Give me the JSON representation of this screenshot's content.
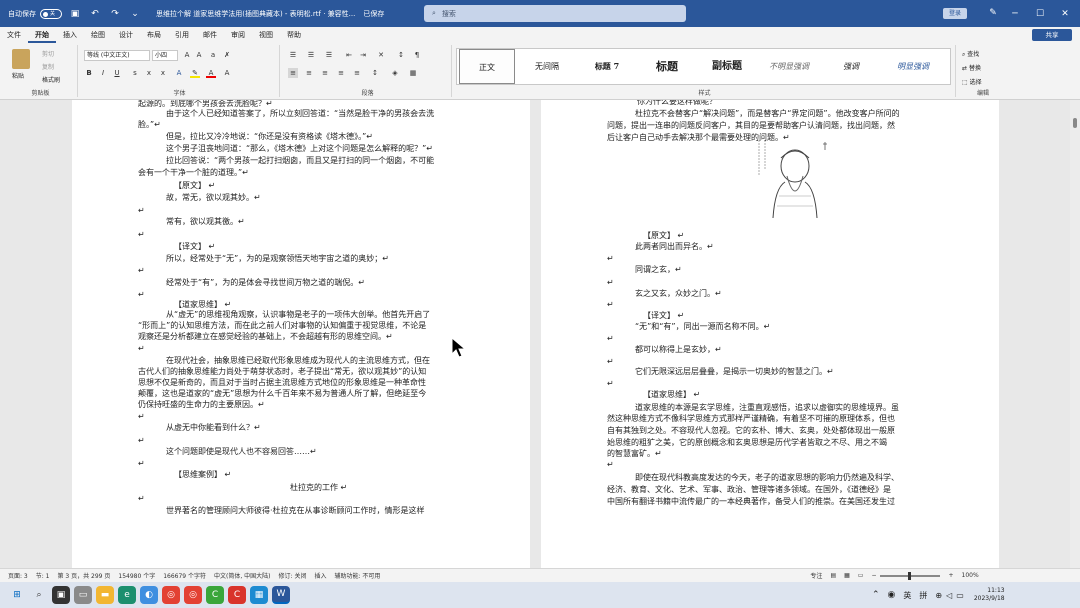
{
  "titlebar": {
    "autosave": "自动保存",
    "toggle": "关",
    "filename": "思维拉个解 道家思维学法用(插图典藏本) - 表明松.rtf · 兼容性...",
    "saved": "已保存",
    "search_placeholder": "搜索",
    "signin": "登录"
  },
  "menu": [
    "文件",
    "开始",
    "插入",
    "绘图",
    "设计",
    "布局",
    "引用",
    "邮件",
    "审阅",
    "视图",
    "帮助"
  ],
  "share": "共享",
  "ribbon": {
    "clipboard": {
      "paste": "粘贴",
      "cut": "剪切",
      "copy": "复制",
      "format_painter": "格式刷",
      "label": "剪贴板"
    },
    "font": {
      "name": "等线 (中文正文)",
      "size": "小四",
      "label": "字体"
    },
    "paragraph": {
      "label": "段落"
    },
    "styles": {
      "items": [
        "正文",
        "无间隔",
        "标题 7",
        "标题",
        "副标题",
        "不明显强调",
        "强调",
        "明显强调"
      ],
      "label": "样式"
    },
    "editing": {
      "find": "查找",
      "replace": "替换",
      "select": "选择",
      "label": "编辑"
    }
  },
  "page_left": [
    "起源的。到底哪个男孩会去洗脸呢？↵",
    "由于这个人已经知道答案了，所以立刻回答道：“当然是脸干净的男孩会去洗",
    "脸。”↵",
    "但是，拉比又冷冷地说：“你还是没有资格读《塔木德》。”↵",
    "这个男子沮丧地问道：“那么，《塔木德》上对这个问题是怎么解释的呢？”↵",
    "拉比回答说：“两个男孩一起打扫烟囱，而且又是打扫的同一个烟囱，不可能",
    "会有一个干净一个脏的道理。”↵",
    "【原文】 ↵",
    "故，常无，欲以观其妙。↵",
    "↵",
    "常有，欲以观其徼。↵",
    "↵",
    "【译文】 ↵",
    "所以，经常处于“无”，为的是观察领悟天地宇宙之道的奥妙；↵",
    "↵",
    "经常处于“有”，为的是体会寻找世间万物之道的端倪。↵",
    "↵",
    "【道家思维】 ↵",
    "从“虚无”的思维视角观察，认识事物是老子的一项伟大创举。他首先开启了",
    "“形而上”的认知思维方法，而在此之前人们对事物的认知偏重于视觉思维，不论是",
    "观察还是分析都建立在感觉经验的基础上，不会超越有形的思维空间。↵",
    "↵",
    "在现代社会，抽象思维已经取代形象思维成为现代人的主流思维方式，但在",
    "古代人们的抽象思维能力尚处于萌芽状态时，老子提出“常无，欲以观其妙”的认知",
    "思想不仅是新奇的，而且对于当时占据主流思维方式地位的形象思维是一种革命性",
    "颠覆，这也是道家的“虚无”思想为什么千百年来不易为普通人所了解，但绝延至今",
    "仍保持旺盛的生命力的主要原因。↵",
    "↵",
    "从虚无中你能看到什么？↵",
    "↵",
    "这个问题即使是现代人也不容易回答……↵",
    "↵",
    "【思维案例】 ↵",
    "杜拉克的工作 ↵",
    "↵",
    "世界著名的管理顾问大师彼得·杜拉克在从事诊断顾问工作时，情形是这样"
  ],
  "page_right": [
    "你为什么要这样做呢？",
    "杜拉克不会替客户“解决问题”，而是替客户“界定问题”。他改变客户所问的",
    "问题，提出一连串的问题反问客户，其目的是要帮助客户认清问题，找出问题，然",
    "后让客户自己动手去解决那个最需要处理的问题。↵",
    "【原文】 ↵",
    "此两者同出而异名。↵",
    "↵",
    "同谓之玄，↵",
    "↵",
    "玄之又玄，众妙之门。↵",
    "↵",
    "【译文】 ↵",
    "“无”和“有”，同出一源而名称不同。↵",
    "↵",
    "都可以称得上是玄妙，↵",
    "↵",
    "它们无限深远层层叠叠，是揭示一切奥妙的智慧之门。↵",
    "↵",
    "【道家思维】 ↵",
    "道家思维的本源是玄学思维，注重直观感悟，追求以虚御实的思维境界。虽",
    "然这种思维方式不像科学思维方式那样严谨精确，有着坚不可摧的原理体系，但也",
    "自有其独到之处。不容现代人忽视。它的玄朴、博大、玄奥，处处都体现出一般原",
    "始思维的粗犷之美，它的原创概念和玄奥思想是历代学者皆取之不尽、用之不竭",
    "的智慧富矿。↵",
    "↵",
    "即使在现代科教高度发达的今天，老子的道家思想的影响力仍然遍及科学、",
    "经济、教育、文化、艺术、军事、政治、管理等诸多领域。在国外，《道德经》是",
    "中国所有翻译书籍中流传最广的一本经典著作，备受人们的推崇。在美国还发生过"
  ],
  "status": {
    "page": "页面: 3",
    "section": "节: 1",
    "page_of": "第 3 页，共 299 页",
    "words": "154980 个字",
    "chars": "166679 个字符",
    "lang": "中文(简体, 中国大陆)",
    "track": "修订: 关闭",
    "insert": "插入",
    "access": "辅助功能: 不可用",
    "focus": "专注",
    "zoom": "100%"
  },
  "taskbar": {
    "ime1": "英",
    "ime2": "拼",
    "time": "11:13",
    "date": "2023/9/18"
  }
}
